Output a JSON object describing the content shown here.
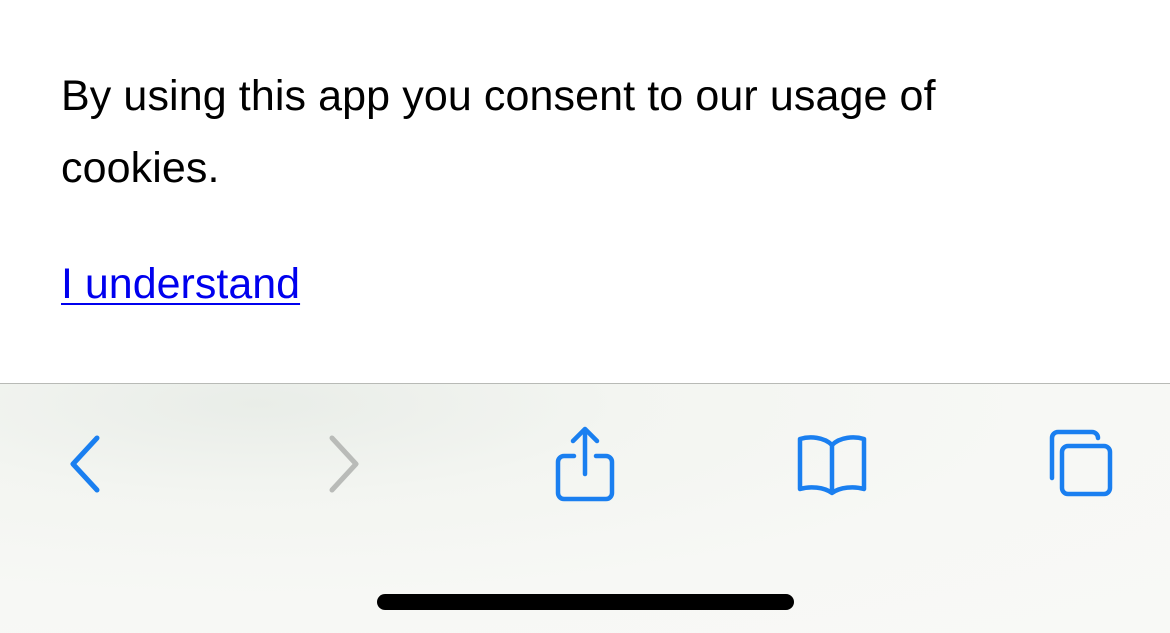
{
  "content": {
    "consent_text": "By using this app you consent to our usage of cookies.",
    "consent_link": "I understand"
  },
  "toolbar": {
    "buttons": [
      {
        "icon": "chevron-left-icon",
        "state": "enabled"
      },
      {
        "icon": "chevron-right-icon",
        "state": "disabled"
      },
      {
        "icon": "share-icon",
        "state": "enabled"
      },
      {
        "icon": "book-icon",
        "state": "enabled"
      },
      {
        "icon": "tabs-icon",
        "state": "enabled"
      }
    ]
  },
  "colors": {
    "link": "#0000ee",
    "accent": "#1a7ff0",
    "disabled": "#b9bbb8",
    "text": "#000000"
  }
}
